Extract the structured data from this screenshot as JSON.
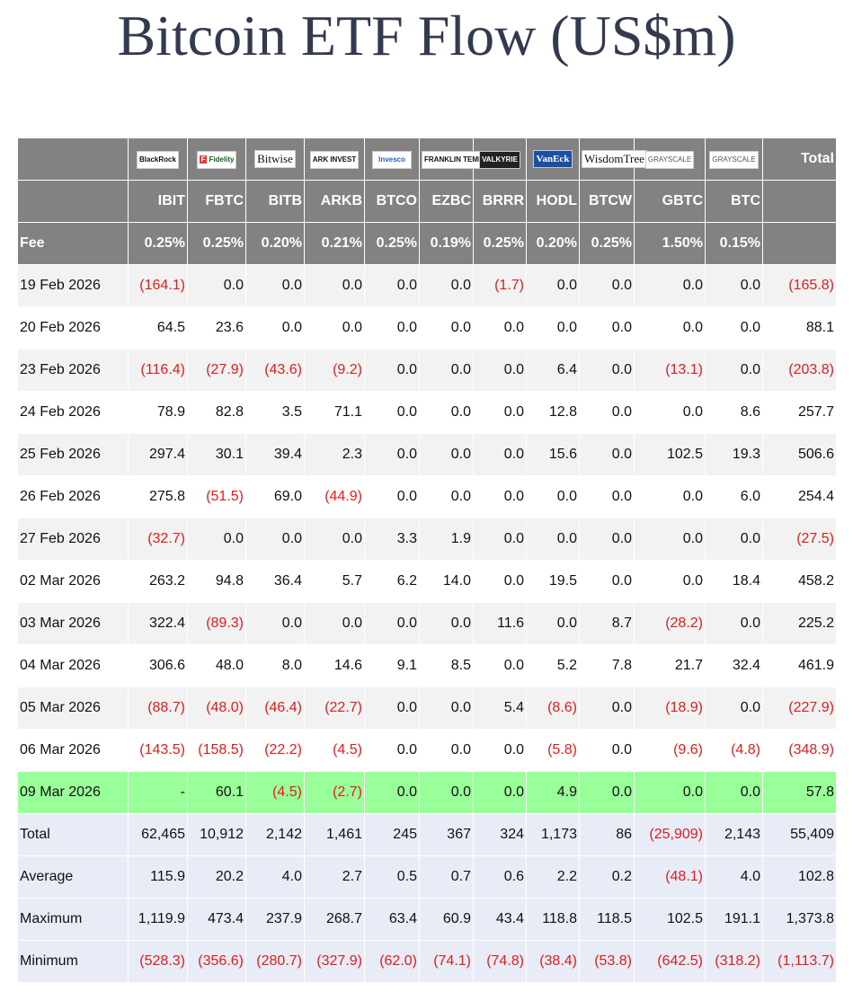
{
  "title": "Bitcoin ETF Flow (US$m)",
  "colors": {
    "header_bg": "#828282",
    "negative": "#e21b1b",
    "highlight_row": "#99ff99",
    "summary_bg": "#e8ecf6"
  },
  "issuers": [
    "BlackRock",
    "Fidelity",
    "Bitwise",
    "ARK INVEST",
    "Invesco",
    "FRANKLIN TEMPLETON",
    "VALKYRIE",
    "VanEck",
    "WisdomTree",
    "GRAYSCALE",
    "GRAYSCALE"
  ],
  "total_header": "Total",
  "fee_label": "Fee",
  "tickers": [
    "IBIT",
    "FBTC",
    "BITB",
    "ARKB",
    "BTCO",
    "EZBC",
    "BRRR",
    "HODL",
    "BTCW",
    "GBTC",
    "BTC"
  ],
  "fees": [
    "0.25%",
    "0.25%",
    "0.20%",
    "0.21%",
    "0.25%",
    "0.19%",
    "0.25%",
    "0.20%",
    "0.25%",
    "1.50%",
    "0.15%"
  ],
  "rows": [
    {
      "date": "19 Feb 2026",
      "values": [
        "(164.1)",
        "0.0",
        "0.0",
        "0.0",
        "0.0",
        "0.0",
        "(1.7)",
        "0.0",
        "0.0",
        "0.0",
        "0.0",
        "(165.8)"
      ]
    },
    {
      "date": "20 Feb 2026",
      "values": [
        "64.5",
        "23.6",
        "0.0",
        "0.0",
        "0.0",
        "0.0",
        "0.0",
        "0.0",
        "0.0",
        "0.0",
        "0.0",
        "88.1"
      ]
    },
    {
      "date": "23 Feb 2026",
      "values": [
        "(116.4)",
        "(27.9)",
        "(43.6)",
        "(9.2)",
        "0.0",
        "0.0",
        "0.0",
        "6.4",
        "0.0",
        "(13.1)",
        "0.0",
        "(203.8)"
      ]
    },
    {
      "date": "24 Feb 2026",
      "values": [
        "78.9",
        "82.8",
        "3.5",
        "71.1",
        "0.0",
        "0.0",
        "0.0",
        "12.8",
        "0.0",
        "0.0",
        "8.6",
        "257.7"
      ]
    },
    {
      "date": "25 Feb 2026",
      "values": [
        "297.4",
        "30.1",
        "39.4",
        "2.3",
        "0.0",
        "0.0",
        "0.0",
        "15.6",
        "0.0",
        "102.5",
        "19.3",
        "506.6"
      ]
    },
    {
      "date": "26 Feb 2026",
      "values": [
        "275.8",
        "(51.5)",
        "69.0",
        "(44.9)",
        "0.0",
        "0.0",
        "0.0",
        "0.0",
        "0.0",
        "0.0",
        "6.0",
        "254.4"
      ]
    },
    {
      "date": "27 Feb 2026",
      "values": [
        "(32.7)",
        "0.0",
        "0.0",
        "0.0",
        "3.3",
        "1.9",
        "0.0",
        "0.0",
        "0.0",
        "0.0",
        "0.0",
        "(27.5)"
      ]
    },
    {
      "date": "02 Mar 2026",
      "values": [
        "263.2",
        "94.8",
        "36.4",
        "5.7",
        "6.2",
        "14.0",
        "0.0",
        "19.5",
        "0.0",
        "0.0",
        "18.4",
        "458.2"
      ]
    },
    {
      "date": "03 Mar 2026",
      "values": [
        "322.4",
        "(89.3)",
        "0.0",
        "0.0",
        "0.0",
        "0.0",
        "11.6",
        "0.0",
        "8.7",
        "(28.2)",
        "0.0",
        "225.2"
      ]
    },
    {
      "date": "04 Mar 2026",
      "values": [
        "306.6",
        "48.0",
        "8.0",
        "14.6",
        "9.1",
        "8.5",
        "0.0",
        "5.2",
        "7.8",
        "21.7",
        "32.4",
        "461.9"
      ]
    },
    {
      "date": "05 Mar 2026",
      "values": [
        "(88.7)",
        "(48.0)",
        "(46.4)",
        "(22.7)",
        "0.0",
        "0.0",
        "5.4",
        "(8.6)",
        "0.0",
        "(18.9)",
        "0.0",
        "(227.9)"
      ]
    },
    {
      "date": "06 Mar 2026",
      "values": [
        "(143.5)",
        "(158.5)",
        "(22.2)",
        "(4.5)",
        "0.0",
        "0.0",
        "0.0",
        "(5.8)",
        "0.0",
        "(9.6)",
        "(4.8)",
        "(348.9)"
      ]
    },
    {
      "date": "09 Mar 2026",
      "values": [
        "-",
        "60.1",
        "(4.5)",
        "(2.7)",
        "0.0",
        "0.0",
        "0.0",
        "4.9",
        "0.0",
        "0.0",
        "0.0",
        "57.8"
      ],
      "highlight": true
    }
  ],
  "summary": [
    {
      "label": "Total",
      "values": [
        "62,465",
        "10,912",
        "2,142",
        "1,461",
        "245",
        "367",
        "324",
        "1,173",
        "86",
        "(25,909)",
        "2,143",
        "55,409"
      ]
    },
    {
      "label": "Average",
      "values": [
        "115.9",
        "20.2",
        "4.0",
        "2.7",
        "0.5",
        "0.7",
        "0.6",
        "2.2",
        "0.2",
        "(48.1)",
        "4.0",
        "102.8"
      ]
    },
    {
      "label": "Maximum",
      "values": [
        "1,119.9",
        "473.4",
        "237.9",
        "268.7",
        "63.4",
        "60.9",
        "43.4",
        "118.8",
        "118.5",
        "102.5",
        "191.1",
        "1,373.8"
      ]
    },
    {
      "label": "Minimum",
      "values": [
        "(528.3)",
        "(356.6)",
        "(280.7)",
        "(327.9)",
        "(62.0)",
        "(74.1)",
        "(74.8)",
        "(38.4)",
        "(53.8)",
        "(642.5)",
        "(318.2)",
        "(1,113.7)"
      ]
    }
  ],
  "chart_data": {
    "type": "table",
    "title": "Bitcoin ETF Flow (US$m)",
    "columns": [
      "IBIT",
      "FBTC",
      "BITB",
      "ARKB",
      "BTCO",
      "EZBC",
      "BRRR",
      "HODL",
      "BTCW",
      "GBTC",
      "BTC",
      "Total"
    ]
  }
}
